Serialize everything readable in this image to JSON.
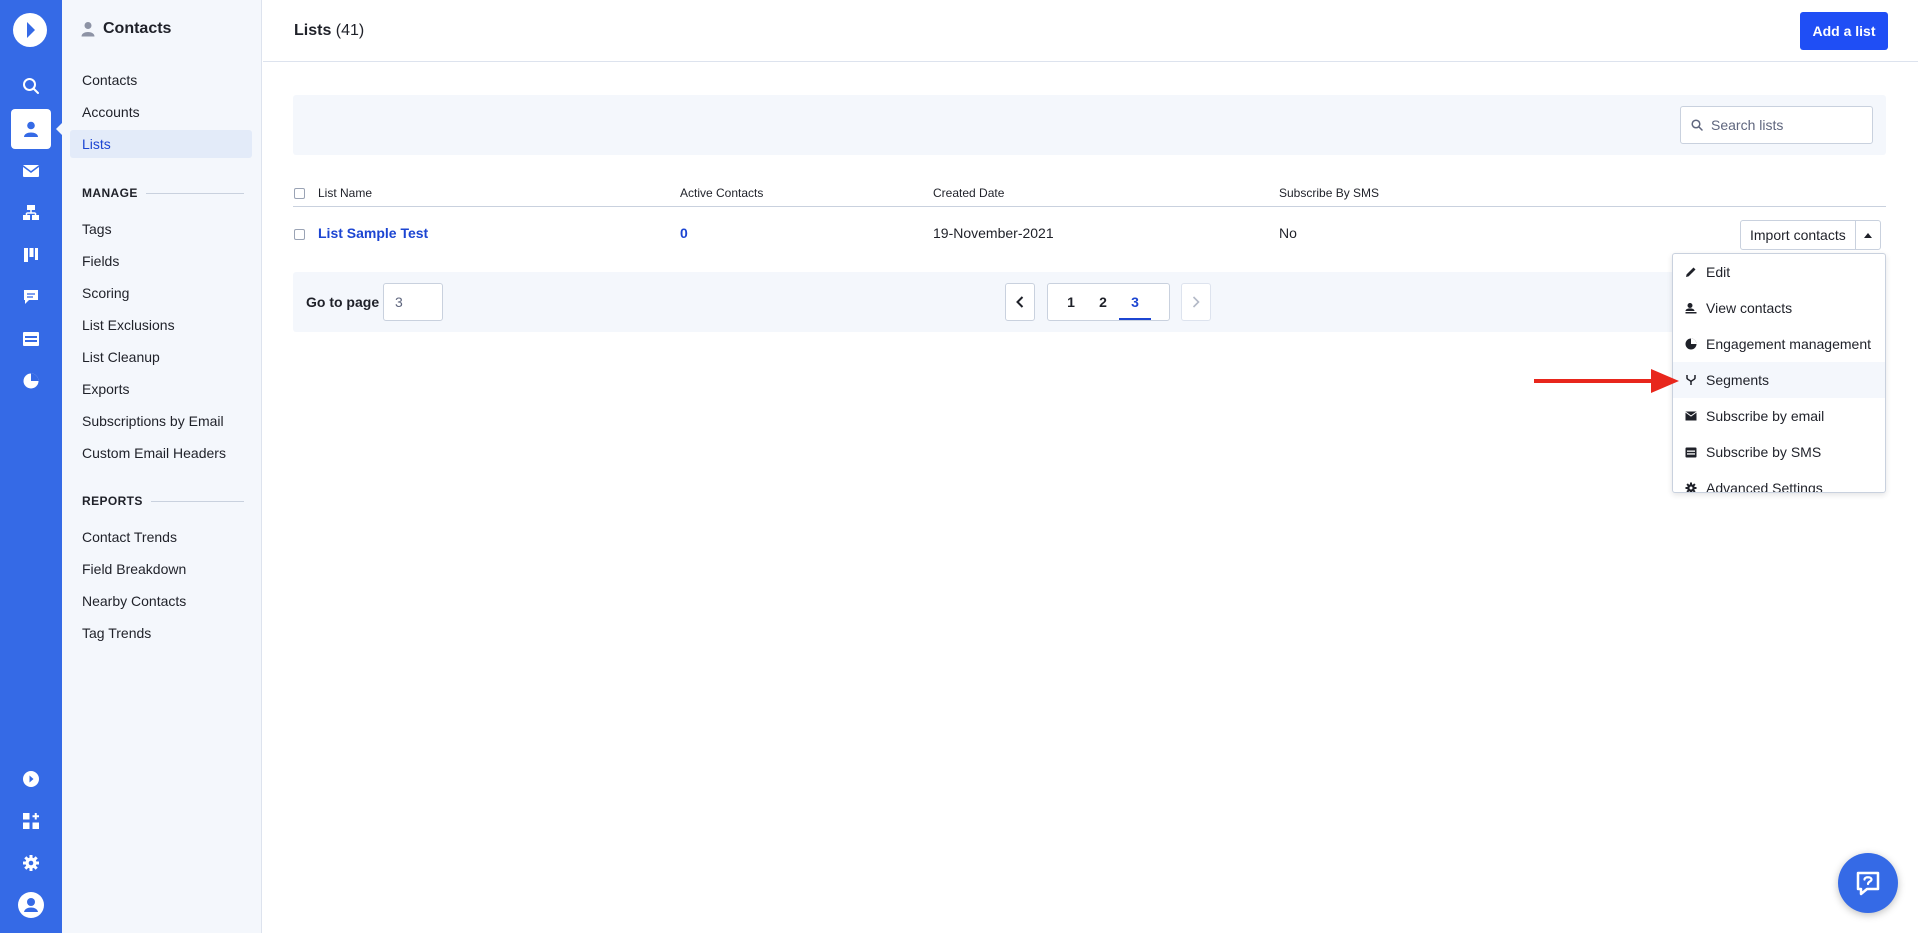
{
  "rail": {
    "items": [
      {
        "icon": "search-icon"
      },
      {
        "icon": "contacts-icon",
        "active": true
      },
      {
        "icon": "envelope-icon"
      },
      {
        "icon": "automations-icon"
      },
      {
        "icon": "deals-board-icon"
      },
      {
        "icon": "conversations-icon"
      },
      {
        "icon": "website-icon"
      },
      {
        "icon": "reports-pie-icon"
      }
    ],
    "bottom_items": [
      {
        "icon": "apps-play-icon"
      },
      {
        "icon": "add-apps-icon"
      },
      {
        "icon": "gear-icon"
      },
      {
        "icon": "user-avatar-icon"
      }
    ],
    "accent": "#356ae6"
  },
  "subnav": {
    "title": "Contacts",
    "items": [
      {
        "label": "Contacts"
      },
      {
        "label": "Accounts"
      },
      {
        "label": "Lists",
        "active": true
      }
    ],
    "manage_heading": "MANAGE",
    "manage_items": [
      {
        "label": "Tags"
      },
      {
        "label": "Fields"
      },
      {
        "label": "Scoring"
      },
      {
        "label": "List Exclusions"
      },
      {
        "label": "List Cleanup"
      },
      {
        "label": "Exports"
      },
      {
        "label": "Subscriptions by Email"
      },
      {
        "label": "Custom Email Headers"
      }
    ],
    "reports_heading": "REPORTS",
    "reports_items": [
      {
        "label": "Contact Trends"
      },
      {
        "label": "Field Breakdown"
      },
      {
        "label": "Nearby Contacts"
      },
      {
        "label": "Tag Trends"
      }
    ]
  },
  "header": {
    "title": "Lists",
    "count": "(41)",
    "add_button": "Add a list",
    "button_color": "#1f4ef5"
  },
  "search": {
    "placeholder": "Search lists",
    "value": ""
  },
  "table": {
    "columns": [
      "List Name",
      "Active Contacts",
      "Created Date",
      "Subscribe By SMS"
    ],
    "rows": [
      {
        "name": "List Sample Test",
        "active_contacts": "0",
        "created_date": "19-November-2021",
        "subscribe_sms": "No",
        "action": "Import contacts"
      }
    ]
  },
  "pagination": {
    "goto_label": "Go to page",
    "goto_value": "3",
    "pages": [
      "1",
      "2",
      "3"
    ],
    "current_page": "3"
  },
  "dropdown": {
    "items": [
      {
        "label": "Edit",
        "icon": "pencil-icon"
      },
      {
        "label": "View contacts",
        "icon": "contacts-list-icon"
      },
      {
        "label": "Engagement management",
        "icon": "pie-chart-icon"
      },
      {
        "label": "Segments",
        "icon": "segments-icon",
        "highlighted": true
      },
      {
        "label": "Subscribe by email",
        "icon": "envelope-icon"
      },
      {
        "label": "Subscribe by SMS",
        "icon": "sms-icon"
      },
      {
        "label": "Advanced Settings",
        "icon": "gear-icon"
      }
    ]
  },
  "annotation": {
    "color": "#e8261c",
    "points_to": "Segments"
  },
  "help": {
    "icon": "help-chat-icon"
  }
}
